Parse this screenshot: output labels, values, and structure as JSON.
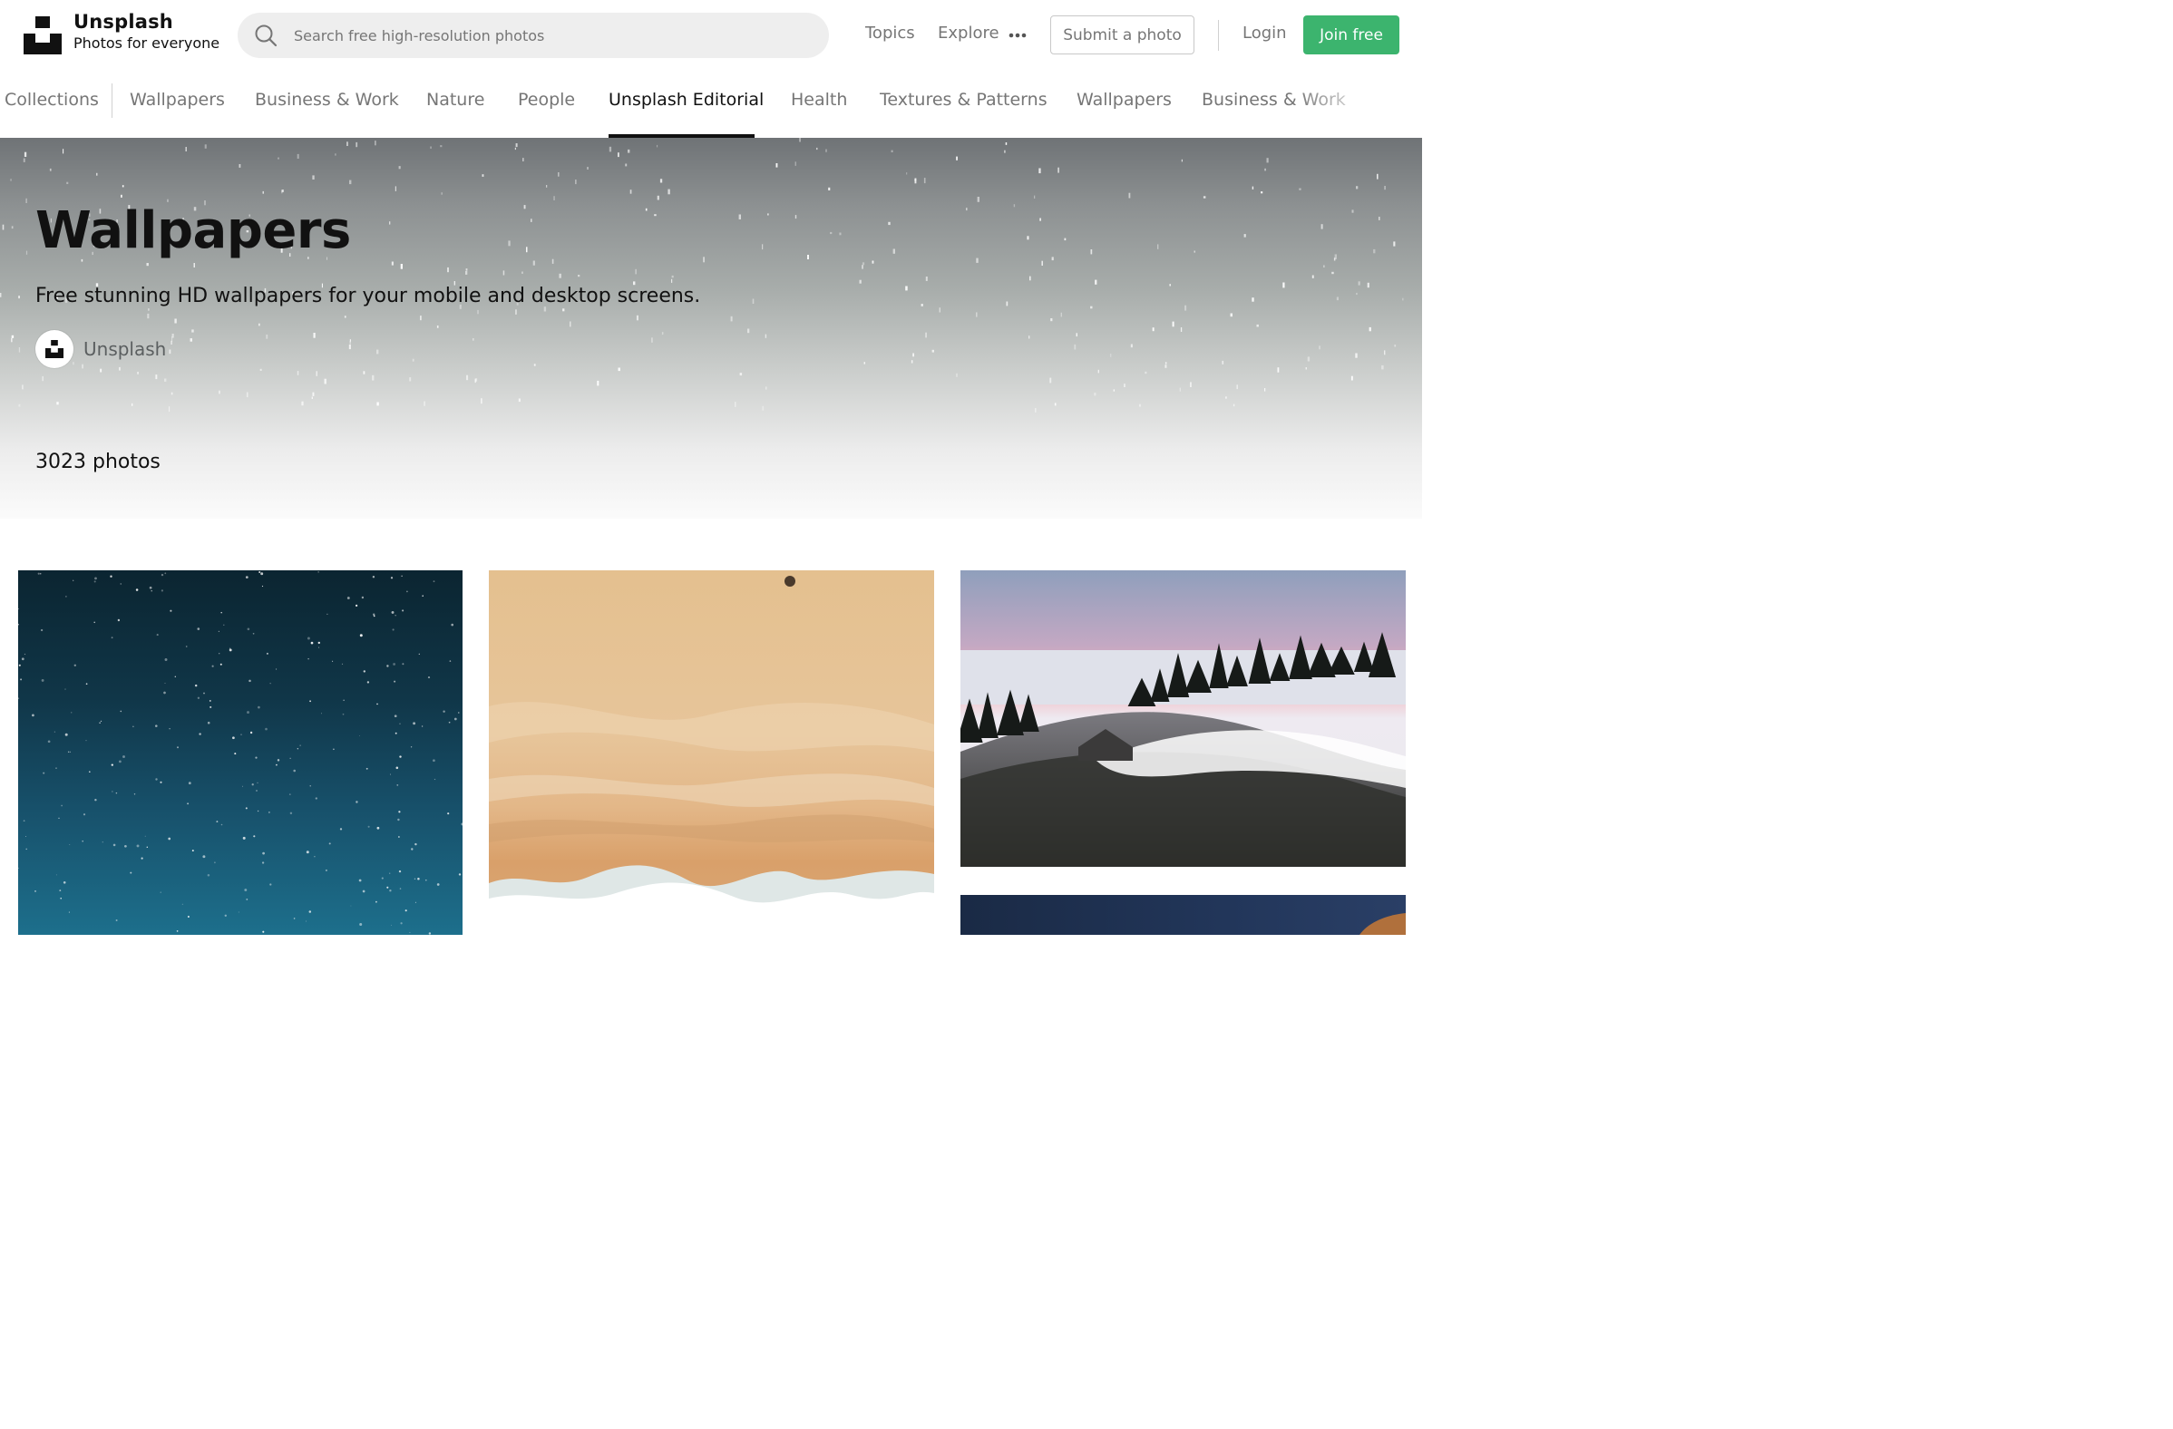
{
  "header": {
    "brand_name": "Unsplash",
    "brand_tagline": "Photos for everyone",
    "search_placeholder": "Search free high-resolution photos",
    "nav_topics": "Topics",
    "nav_explore": "Explore",
    "submit_label": "Submit a photo",
    "login_label": "Login",
    "join_label": "Join free",
    "join_color": "#3cb46e"
  },
  "topics": {
    "items": [
      "Collections",
      "Wallpapers",
      "Business & Work",
      "Nature",
      "People",
      "Unsplash Editorial",
      "Health",
      "Textures & Patterns",
      "Wallpapers",
      "Business & Work"
    ],
    "active": "Unsplash Editorial"
  },
  "hero": {
    "title": "Wallpapers",
    "description": "Free stunning HD wallpapers for your mobile and desktop screens.",
    "curator": "Unsplash",
    "photo_count": "3023 photos"
  },
  "photos": [
    {
      "subject": "starry-night-sky",
      "colors": [
        "#0b2531",
        "#1d6f8c"
      ]
    },
    {
      "subject": "aerial-beach",
      "colors": [
        "#e2b685",
        "#ffffff"
      ]
    },
    {
      "subject": "foggy-hill-sunrise",
      "colors": [
        "#e6a6b8",
        "#2b2d2a"
      ]
    },
    {
      "subject": "dark-blue-landscape",
      "colors": [
        "#1a2a45"
      ]
    }
  ]
}
